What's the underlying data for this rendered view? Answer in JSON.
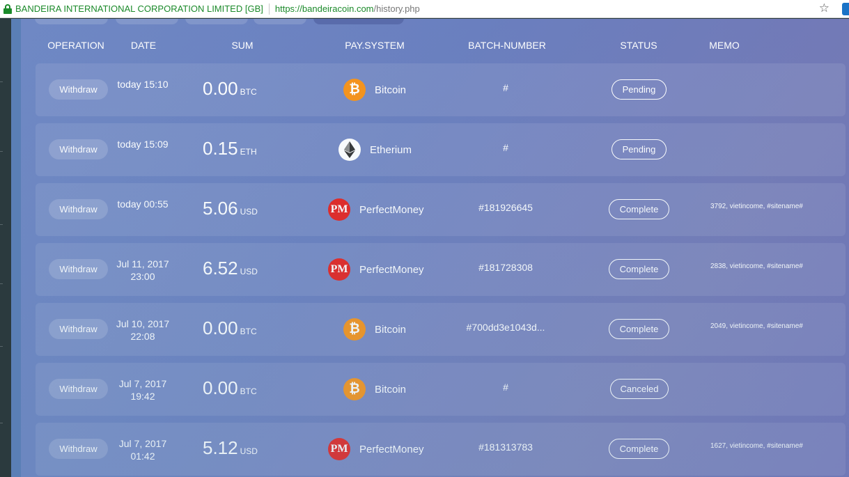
{
  "browser": {
    "site_name": "BANDEIRA INTERNATIONAL CORPORATION LIMITED [GB]",
    "url_host": "https://bandeiracoin.com",
    "url_path": "/history.php"
  },
  "table": {
    "headers": {
      "operation": "OPERATION",
      "date": "DATE",
      "sum": "SUM",
      "pay_system": "PAY.SYSTEM",
      "batch": "BATCH-NUMBER",
      "status": "STATUS",
      "memo": "MEMO"
    },
    "rows": [
      {
        "operation": "Withdraw",
        "date1": "today 15:10",
        "date2": "",
        "amount": "0.00",
        "unit": "BTC",
        "icon": "bitcoin-icon",
        "pay": "Bitcoin",
        "batch": "#",
        "status": "Pending",
        "memo": ""
      },
      {
        "operation": "Withdraw",
        "date1": "today 15:09",
        "date2": "",
        "amount": "0.15",
        "unit": "ETH",
        "icon": "ethereum-icon",
        "pay": "Etherium",
        "batch": "#",
        "status": "Pending",
        "memo": ""
      },
      {
        "operation": "Withdraw",
        "date1": "today 00:55",
        "date2": "",
        "amount": "5.06",
        "unit": "USD",
        "icon": "perfectmoney-icon",
        "pay": "PerfectMoney",
        "batch": "#181926645",
        "status": "Complete",
        "memo": "3792, vietincome, #sitename#"
      },
      {
        "operation": "Withdraw",
        "date1": "Jul 11, 2017",
        "date2": "23:00",
        "amount": "6.52",
        "unit": "USD",
        "icon": "perfectmoney-icon",
        "pay": "PerfectMoney",
        "batch": "#181728308",
        "status": "Complete",
        "memo": "2838, vietincome, #sitename#"
      },
      {
        "operation": "Withdraw",
        "date1": "Jul 10, 2017",
        "date2": "22:08",
        "amount": "0.00",
        "unit": "BTC",
        "icon": "bitcoin-icon",
        "pay": "Bitcoin",
        "batch": "#700dd3e1043d...",
        "status": "Complete",
        "memo": "2049, vietincome, #sitename#"
      },
      {
        "operation": "Withdraw",
        "date1": "Jul 7, 2017",
        "date2": "19:42",
        "amount": "0.00",
        "unit": "BTC",
        "icon": "bitcoin-icon",
        "pay": "Bitcoin",
        "batch": "#",
        "status": "Canceled",
        "memo": ""
      },
      {
        "operation": "Withdraw",
        "date1": "Jul 7, 2017",
        "date2": "01:42",
        "amount": "5.12",
        "unit": "USD",
        "icon": "perfectmoney-icon",
        "pay": "PerfectMoney",
        "batch": "#181313783",
        "status": "Complete",
        "memo": "1627, vietincome, #sitename#"
      }
    ]
  },
  "colors": {
    "accent_green": "#1b8a2a",
    "bitcoin": "#f7931a",
    "perfectmoney": "#e52421"
  }
}
